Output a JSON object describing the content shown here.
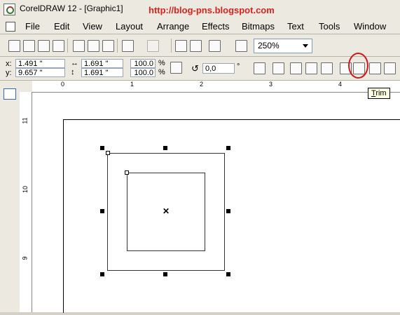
{
  "window": {
    "title": "CorelDRAW 12 - [Graphic1]",
    "watermark": "http://blog-pns.blogspot.com"
  },
  "menu": [
    "File",
    "Edit",
    "View",
    "Layout",
    "Arrange",
    "Effects",
    "Bitmaps",
    "Text",
    "Tools",
    "Window"
  ],
  "standard_toolbar": {
    "icons": [
      "new-icon",
      "open-icon",
      "save-icon",
      "print-icon",
      "cut-icon",
      "copy-icon",
      "paste-icon",
      "undo-icon",
      "redo-icon",
      "import-icon",
      "export-icon",
      "application-launcher-icon",
      "welcome-screen-icon"
    ],
    "zoom_level": "250%"
  },
  "property_bar": {
    "x_label": "x:",
    "x_value": "1.491 \"",
    "y_label": "y:",
    "y_value": "9.657 \"",
    "width_value": "1.691 \"",
    "height_value": "1.691 \"",
    "scale_x": "100.0",
    "scale_y": "100.0",
    "percent_sign": "%",
    "rotation_value": "0,0",
    "degree_sign": "°",
    "shaping_icons": [
      "weld-icon",
      "trim-icon",
      "intersect-icon",
      "simplify-icon",
      "front-minus-back-icon",
      "back-minus-front-icon"
    ]
  },
  "tooltip": {
    "underlined": "T",
    "rest": "rim"
  },
  "rulers": {
    "horizontal_ticks": [
      "0",
      "1",
      "2",
      "3",
      "4"
    ],
    "vertical_ticks": [
      "11",
      "10",
      "9"
    ]
  },
  "toolbox": [
    "pick-tool-icon",
    "shape-tool-icon",
    "smudge-tool-icon",
    "zoom-tool-icon",
    "freehand-tool-icon",
    "smart-fill-icon",
    "rectangle-tool-icon",
    "ellipse-tool-icon",
    "graph-paper-icon",
    "basic-shapes-icon",
    "text-tool-icon",
    "interactive-blend-icon",
    "eyedropper-icon",
    "outline-tool-icon",
    "fill-tool-icon"
  ]
}
